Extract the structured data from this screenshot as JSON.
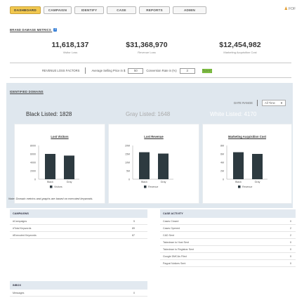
{
  "nav": {
    "tabs": [
      "DASHBOARD",
      "CAMPAIGN",
      "IDENTIFY",
      "CASE",
      "REPORTS",
      "ADMIN"
    ],
    "user": "FOF"
  },
  "brand_metrics": {
    "title": "BRAND DAMAGE METRICS",
    "info": "?",
    "metrics": [
      {
        "value": "11,618,137",
        "label": "Visitor Loss"
      },
      {
        "value": "$31,368,970",
        "label": "Revenue Loss"
      },
      {
        "value": "$12,454,982",
        "label": "Marketing Acquisition Cost"
      }
    ],
    "factors": {
      "title": "REVENUE LOSS FACTORS",
      "avg_label": "Average Selling Price in $",
      "avg_value": "50",
      "conv_label": "Conversion Rate in (%)",
      "conv_value": "3",
      "go": "Submit"
    }
  },
  "identified": {
    "title": "IDENTIFIED DOMAINS",
    "date_range_label": "DATE RANGE",
    "date_range_value": "All Time",
    "black": "Black Listed: 1828",
    "gray": "Gray Listed: 1648",
    "white": "White Listed: 4170",
    "note": "Note: Domain metrics and graphs are based on executed keywords."
  },
  "chart_data": [
    {
      "type": "bar",
      "title": "Lost Visitors",
      "categories": [
        "Black Listed",
        "Gray Listed"
      ],
      "series": [
        {
          "name": "Visitors",
          "values": [
            6000,
            5600
          ]
        }
      ],
      "y_ticks": [
        "8000",
        "6000",
        "4000",
        "2000",
        "0"
      ],
      "category_labels": [
        "Black",
        "Gray"
      ],
      "ylim": [
        0,
        8000
      ],
      "legend": "Visitors"
    },
    {
      "type": "bar",
      "title": "Lost Revenue",
      "categories": [
        "Black Listed",
        "Gray Listed"
      ],
      "series": [
        {
          "name": "Revenue",
          "values": [
            16000000,
            15200000
          ]
        }
      ],
      "y_ticks": [
        "20M",
        "15M",
        "10M",
        "5M",
        "0"
      ],
      "category_labels": [
        "Black",
        "Gray"
      ],
      "ylim": [
        0,
        20000000
      ],
      "legend": "Revenue"
    },
    {
      "type": "bar",
      "title": "Marketing Acquisition Cost",
      "categories": [
        "Black Listed",
        "Gray Listed"
      ],
      "series": [
        {
          "name": "Revenue",
          "values": [
            6400000,
            6000000
          ]
        }
      ],
      "y_ticks": [
        "8M",
        "6M",
        "4M",
        "2M",
        "0"
      ],
      "category_labels": [
        "Black",
        "Gray"
      ],
      "ylim": [
        0,
        8000000
      ],
      "legend": "Revenue"
    }
  ],
  "campaigns": {
    "title": "CAMPAIGNS",
    "rows": [
      {
        "label": "#Campaigns",
        "value": "5"
      },
      {
        "label": "#Total Keywords",
        "value": "89"
      },
      {
        "label": "#Executed Keywords",
        "value": "87"
      }
    ]
  },
  "inbox": {
    "title": "INBOX",
    "rows": [
      {
        "label": "Messages",
        "value": "0"
      }
    ]
  },
  "case_activity": {
    "title": "CASE ACTIVITY",
    "rows": [
      {
        "label": "Cases Closed",
        "value": "0"
      },
      {
        "label": "Cases Opened",
        "value": "2"
      },
      {
        "label": "C&D Sent",
        "value": "2"
      },
      {
        "label": "Takedown to Host Sent",
        "value": "0"
      },
      {
        "label": "Takedown to Registrar Sent",
        "value": "0"
      },
      {
        "label": "Google DMCAs Filed",
        "value": "0"
      },
      {
        "label": "Paypal Notices Sent",
        "value": "0"
      }
    ]
  }
}
